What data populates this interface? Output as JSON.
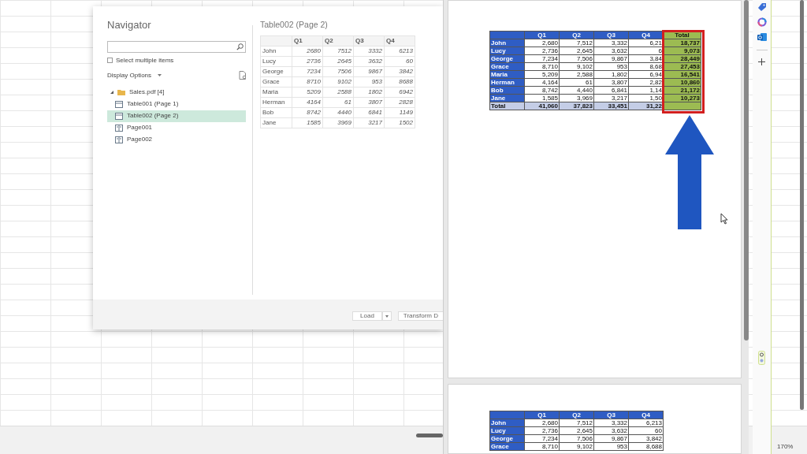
{
  "navigator": {
    "title": "Navigator",
    "select_multiple": {
      "label": "Select multiple items",
      "checked": false
    },
    "display_options": "Display Options",
    "tree": [
      {
        "label": "Sales.pdf [4]",
        "expanded": true,
        "children": [
          {
            "label": "Table001 (Page 1)",
            "kind": "table",
            "selected": false
          },
          {
            "label": "Table002 (Page 2)",
            "kind": "table",
            "selected": true
          },
          {
            "label": "Page001",
            "kind": "page",
            "selected": false
          },
          {
            "label": "Page002",
            "kind": "page",
            "selected": false
          }
        ]
      }
    ],
    "preview": {
      "title": "Table002 (Page 2)",
      "columns": [
        "Q1",
        "Q2",
        "Q3",
        "Q4"
      ],
      "rows": [
        {
          "name": "John",
          "values": [
            "2680",
            "7512",
            "3332",
            "6213"
          ]
        },
        {
          "name": "Lucy",
          "values": [
            "2736",
            "2645",
            "3632",
            "60"
          ]
        },
        {
          "name": "George",
          "values": [
            "7234",
            "7506",
            "9867",
            "3842"
          ]
        },
        {
          "name": "Grace",
          "values": [
            "8710",
            "9102",
            "953",
            "8688"
          ]
        },
        {
          "name": "Maria",
          "values": [
            "5209",
            "2588",
            "1802",
            "6942"
          ]
        },
        {
          "name": "Herman",
          "values": [
            "4164",
            "61",
            "3807",
            "2828"
          ]
        },
        {
          "name": "Bob",
          "values": [
            "8742",
            "4440",
            "6841",
            "1149"
          ]
        },
        {
          "name": "Jane",
          "values": [
            "1585",
            "3969",
            "3217",
            "1502"
          ]
        }
      ]
    },
    "buttons": [
      {
        "label": "Load",
        "kind": "split"
      },
      {
        "label": "Transform D",
        "kind": "plain"
      }
    ]
  },
  "pdf_pages": [
    {
      "columns": [
        "Q1",
        "Q2",
        "Q3",
        "Q4",
        "Total"
      ],
      "highlight_last_column": true,
      "rows": [
        {
          "name": "John",
          "values": [
            "2,680",
            "7,512",
            "3,332",
            "6,21",
            "18,737"
          ]
        },
        {
          "name": "Lucy",
          "values": [
            "2,736",
            "2,645",
            "3,632",
            "6",
            "9,073"
          ]
        },
        {
          "name": "George",
          "values": [
            "7,234",
            "7,506",
            "9,867",
            "3,84",
            "28,449"
          ]
        },
        {
          "name": "Grace",
          "values": [
            "8,710",
            "9,102",
            "953",
            "8,68",
            "27,453"
          ]
        },
        {
          "name": "Maria",
          "values": [
            "5,209",
            "2,588",
            "1,802",
            "6,94",
            "16,541"
          ]
        },
        {
          "name": "Herman",
          "values": [
            "4,164",
            "61",
            "3,807",
            "2,82",
            "10,860"
          ]
        },
        {
          "name": "Bob",
          "values": [
            "8,742",
            "4,440",
            "6,841",
            "1,14",
            "21,172"
          ]
        },
        {
          "name": "Jane",
          "values": [
            "1,585",
            "3,969",
            "3,217",
            "1,50",
            "10,273"
          ]
        }
      ],
      "total": {
        "name": "Total",
        "values": [
          "41,060",
          "37,823",
          "33,451",
          "31,22"
        ]
      }
    },
    {
      "columns": [
        "Q1",
        "Q2",
        "Q3",
        "Q4"
      ],
      "highlight_last_column": false,
      "rows": [
        {
          "name": "John",
          "values": [
            "2,680",
            "7,512",
            "3,332",
            "6,213"
          ]
        },
        {
          "name": "Lucy",
          "values": [
            "2,736",
            "2,645",
            "3,632",
            "60"
          ]
        },
        {
          "name": "George",
          "values": [
            "7,234",
            "7,506",
            "9,867",
            "3,842"
          ]
        },
        {
          "name": "Grace",
          "values": [
            "8,710",
            "9,102",
            "953",
            "8,688"
          ]
        }
      ]
    }
  ],
  "zoom": "170%"
}
